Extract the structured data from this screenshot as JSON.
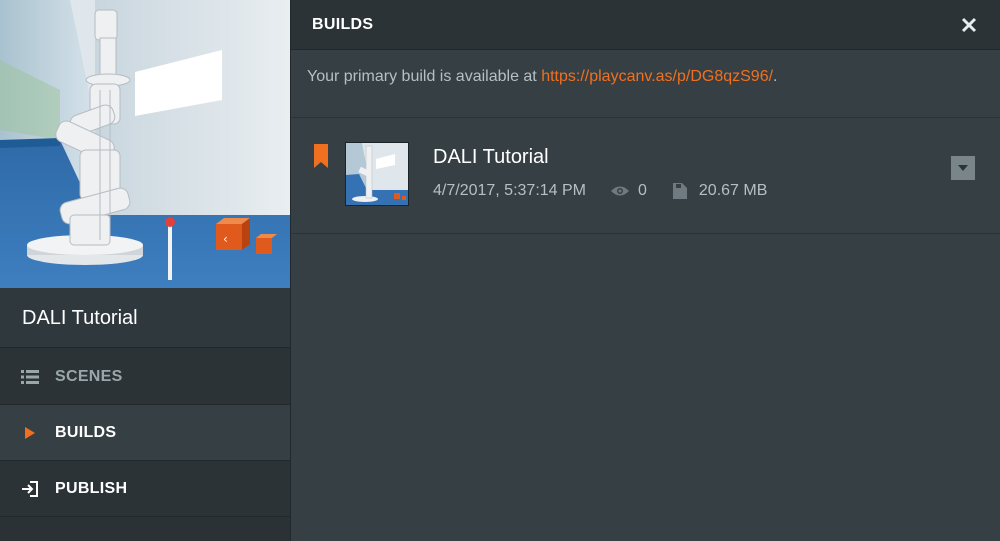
{
  "sidebar": {
    "project_title": "DALI Tutorial",
    "nav": [
      {
        "label": "SCENES",
        "icon": "list-icon",
        "active": false
      },
      {
        "label": "BUILDS",
        "icon": "play-triangle-icon",
        "active": true
      },
      {
        "label": "PUBLISH",
        "icon": "publish-icon",
        "active": false
      }
    ]
  },
  "panel": {
    "title": "BUILDS",
    "close_icon": "close-icon",
    "primary_text": "Your primary build is available at ",
    "primary_link": "https://playcanv.as/p/DG8qzS96/",
    "primary_suffix": ".",
    "builds": [
      {
        "name": "DALI Tutorial",
        "date": "4/7/2017, 5:37:14 PM",
        "views": "0",
        "size": "20.67 MB",
        "primary": true
      }
    ]
  },
  "colors": {
    "accent": "#f0701f",
    "background": "#2b3337",
    "panel": "#364044"
  }
}
